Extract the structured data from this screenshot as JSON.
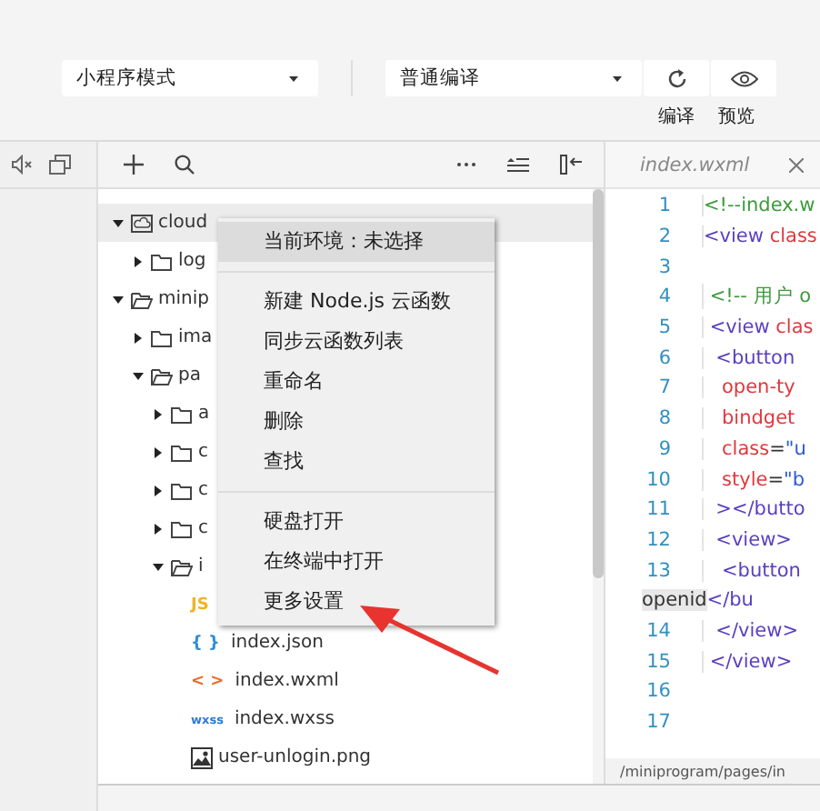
{
  "toolbar": {
    "mode_select": {
      "value": "小程序模式"
    },
    "compile_select": {
      "value": "普通编译"
    },
    "buttons": [
      {
        "kind": "refresh",
        "label": "编译"
      },
      {
        "kind": "preview",
        "label": "预览"
      }
    ]
  },
  "file_tree": [
    {
      "name": "cloud",
      "kind": "cloud-folder",
      "expanded": true,
      "selected": true,
      "children": [
        {
          "name": "log",
          "kind": "folder",
          "expanded": false
        }
      ]
    },
    {
      "name": "minip",
      "kind": "folder",
      "expanded": true,
      "selected": false,
      "children": [
        {
          "name": "ima",
          "kind": "folder",
          "expanded": false
        },
        {
          "name": "pa",
          "kind": "folder",
          "expanded": true,
          "children": [
            {
              "name": "a",
              "kind": "folder",
              "expanded": false
            },
            {
              "name": "c",
              "kind": "folder",
              "expanded": false
            },
            {
              "name": "c",
              "kind": "folder",
              "expanded": false
            },
            {
              "name": "c",
              "kind": "folder",
              "expanded": false
            },
            {
              "name": "i",
              "kind": "folder",
              "expanded": true,
              "children": [
                {
                  "kind": "js",
                  "badge": "JS"
                },
                {
                  "name": "index.json",
                  "kind": "json",
                  "badge": "{ }"
                },
                {
                  "name": "index.wxml",
                  "kind": "wxml",
                  "badge": "< >"
                },
                {
                  "name": "index.wxss",
                  "kind": "wxss",
                  "badge": "wxss"
                },
                {
                  "name": "user-unlogin.png",
                  "kind": "image"
                }
              ]
            }
          ]
        }
      ]
    }
  ],
  "editor": {
    "tab": {
      "title": "index.wxml"
    },
    "lines": [
      {
        "number": "1",
        "parts": [
          {
            "kind": "comment",
            "text": "<!--index.w"
          }
        ]
      },
      {
        "number": "2",
        "parts": [
          {
            "kind": "tag",
            "text": "<view "
          },
          {
            "kind": "attr",
            "text": "class"
          }
        ]
      },
      {
        "number": "3"
      },
      {
        "number": "4",
        "parts": [
          {
            "kind": "comment",
            "text": " <!-- 用户 o"
          }
        ]
      },
      {
        "number": "5",
        "parts": [
          {
            "kind": "tag",
            "text": " <view "
          },
          {
            "kind": "attr",
            "text": "clas"
          }
        ]
      },
      {
        "number": "6",
        "parts": [
          {
            "kind": "tag",
            "text": "  <button"
          }
        ]
      },
      {
        "number": "7",
        "parts": [
          {
            "kind": "attr",
            "text": "   open-ty"
          }
        ]
      },
      {
        "number": "8",
        "parts": [
          {
            "kind": "attr",
            "text": "   bindget"
          }
        ]
      },
      {
        "number": "9",
        "parts": [
          {
            "kind": "attr",
            "text": "   class"
          },
          {
            "kind": "punct",
            "text": "="
          },
          {
            "kind": "string",
            "text": "\"u"
          }
        ]
      },
      {
        "number": "10",
        "parts": [
          {
            "kind": "attr",
            "text": "   style"
          },
          {
            "kind": "punct",
            "text": "="
          },
          {
            "kind": "string",
            "text": "\"b"
          }
        ]
      },
      {
        "number": "11",
        "parts": [
          {
            "kind": "tag",
            "text": "  ></butto"
          }
        ]
      },
      {
        "number": "12",
        "parts": [
          {
            "kind": "tag",
            "text": "  <view>"
          }
        ]
      },
      {
        "number": "13",
        "parts": [
          {
            "kind": "tag",
            "text": "   <button"
          }
        ],
        "wrap": [
          {
            "kind": "selected",
            "text": "openid"
          },
          {
            "kind": "tag",
            "text": "</bu"
          }
        ]
      },
      {
        "number": "14",
        "parts": [
          {
            "kind": "tag",
            "text": "  </view>"
          }
        ]
      },
      {
        "number": "15",
        "parts": [
          {
            "kind": "tag",
            "text": " </view>"
          }
        ]
      },
      {
        "number": "16"
      },
      {
        "number": "17"
      }
    ],
    "status_path": "/miniprogram/pages/in"
  },
  "context_menu": {
    "items": [
      {
        "kind": "item",
        "label": "当前环境：未选择",
        "selected": true
      },
      {
        "kind": "separator"
      },
      {
        "kind": "item",
        "label": "新建 Node.js 云函数",
        "selected": false
      },
      {
        "kind": "item",
        "label": "同步云函数列表",
        "selected": false
      },
      {
        "kind": "item",
        "label": "重命名",
        "selected": false
      },
      {
        "kind": "item",
        "label": "删除",
        "selected": false
      },
      {
        "kind": "item",
        "label": "查找",
        "selected": false
      },
      {
        "kind": "separator"
      },
      {
        "kind": "item",
        "label": "硬盘打开",
        "selected": false
      },
      {
        "kind": "item",
        "label": "在终端中打开",
        "selected": false
      },
      {
        "kind": "item",
        "label": "更多设置",
        "selected": false
      }
    ]
  }
}
